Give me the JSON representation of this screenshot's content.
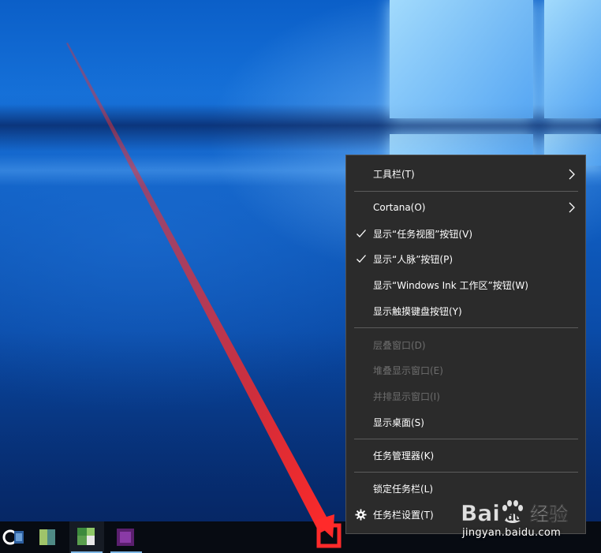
{
  "context_menu": {
    "items": [
      {
        "label": "工具栏(T)",
        "checked": false,
        "submenu": true,
        "disabled": false
      },
      {
        "label": "Cortana(O)",
        "checked": false,
        "submenu": true,
        "disabled": false
      },
      {
        "label": "显示“任务视图”按钮(V)",
        "checked": true,
        "submenu": false,
        "disabled": false
      },
      {
        "label": "显示“人脉”按钮(P)",
        "checked": true,
        "submenu": false,
        "disabled": false
      },
      {
        "label": "显示“Windows Ink 工作区”按钮(W)",
        "checked": false,
        "submenu": false,
        "disabled": false
      },
      {
        "label": "显示触摸键盘按钮(Y)",
        "checked": false,
        "submenu": false,
        "disabled": false
      },
      {
        "label": "层叠窗口(D)",
        "checked": false,
        "submenu": false,
        "disabled": true
      },
      {
        "label": "堆叠显示窗口(E)",
        "checked": false,
        "submenu": false,
        "disabled": true
      },
      {
        "label": "并排显示窗口(I)",
        "checked": false,
        "submenu": false,
        "disabled": true
      },
      {
        "label": "显示桌面(S)",
        "checked": false,
        "submenu": false,
        "disabled": false
      },
      {
        "label": "任务管理器(K)",
        "checked": false,
        "submenu": false,
        "disabled": false
      },
      {
        "label": "锁定任务栏(L)",
        "checked": false,
        "submenu": false,
        "disabled": false
      },
      {
        "label": "任务栏设置(T)",
        "checked": false,
        "submenu": false,
        "disabled": false,
        "icon": "gear-icon"
      }
    ]
  },
  "taskbar": {
    "apps": [
      {
        "name": "cortana-app"
      },
      {
        "name": "app-green"
      },
      {
        "name": "app-green-active"
      },
      {
        "name": "app-purple"
      }
    ]
  },
  "watermark": {
    "brand": "Baidu经验",
    "url": "jingyan.baidu.com"
  },
  "colors": {
    "menu_bg": "#2b2b2b",
    "menu_text": "#ffffff",
    "menu_disabled_text": "#6d6d6d",
    "annotation_red": "#e83030",
    "taskbar_bg": "#070b12"
  }
}
